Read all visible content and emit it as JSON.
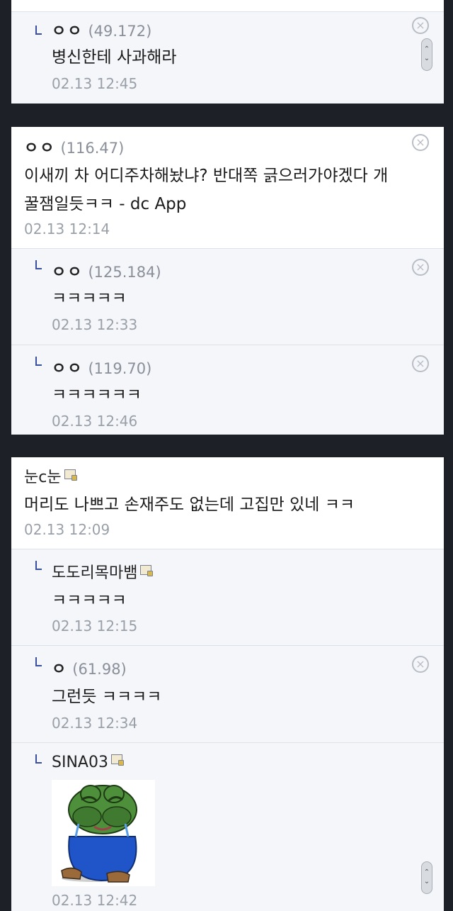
{
  "colors": {
    "background": "#1d2026",
    "reply_background": "#f4f6fa",
    "reply_arrow": "#3a4fa0",
    "date": "#9aa0a8"
  },
  "blocks": [
    {
      "replies": [
        {
          "nick": "ㅇㅇ",
          "ip": "(49.172)",
          "text": "병신한테 사과해라",
          "date": "02.13 12:45",
          "deletable": true
        }
      ]
    },
    {
      "comment": {
        "nick": "ㅇㅇ",
        "ip": "(116.47)",
        "text": "이새끼 차 어디주차해놨냐? 반대쪽 긁으러가야겠다 개",
        "text_line2": "꿀잼일듯ㅋㅋ - dc App",
        "date": "02.13 12:14",
        "deletable": true
      },
      "replies": [
        {
          "nick": "ㅇㅇ",
          "ip": "(125.184)",
          "text": "ㅋㅋㅋㅋㅋ",
          "date": "02.13 12:33",
          "deletable": true
        },
        {
          "nick": "ㅇㅇ",
          "ip": "(119.70)",
          "text": "ㅋㅋㅋㅋㅋㅋ",
          "date": "02.13 12:46",
          "deletable": true
        }
      ]
    },
    {
      "comment": {
        "nick": "눈c눈",
        "icon": "gallery-member-icon",
        "text": "머리도 나쁘고 손재주도 없는데 고집만 있네 ㅋㅋ",
        "date": "02.13 12:09"
      },
      "replies": [
        {
          "nick": "도도리목마뱀",
          "icon": "gallery-member-icon",
          "text": "ㅋㅋㅋㅋㅋ",
          "date": "02.13 12:15"
        },
        {
          "nick": "ㅇ",
          "ip": "(61.98)",
          "text": "그런듯 ㅋㅋㅋㅋ",
          "date": "02.13 12:34",
          "deletable": true
        },
        {
          "nick": "SINA03",
          "icon": "gallery-member-icon",
          "image": "crying-pepe-frog-sticker",
          "date": "02.13 12:42"
        }
      ]
    }
  ]
}
